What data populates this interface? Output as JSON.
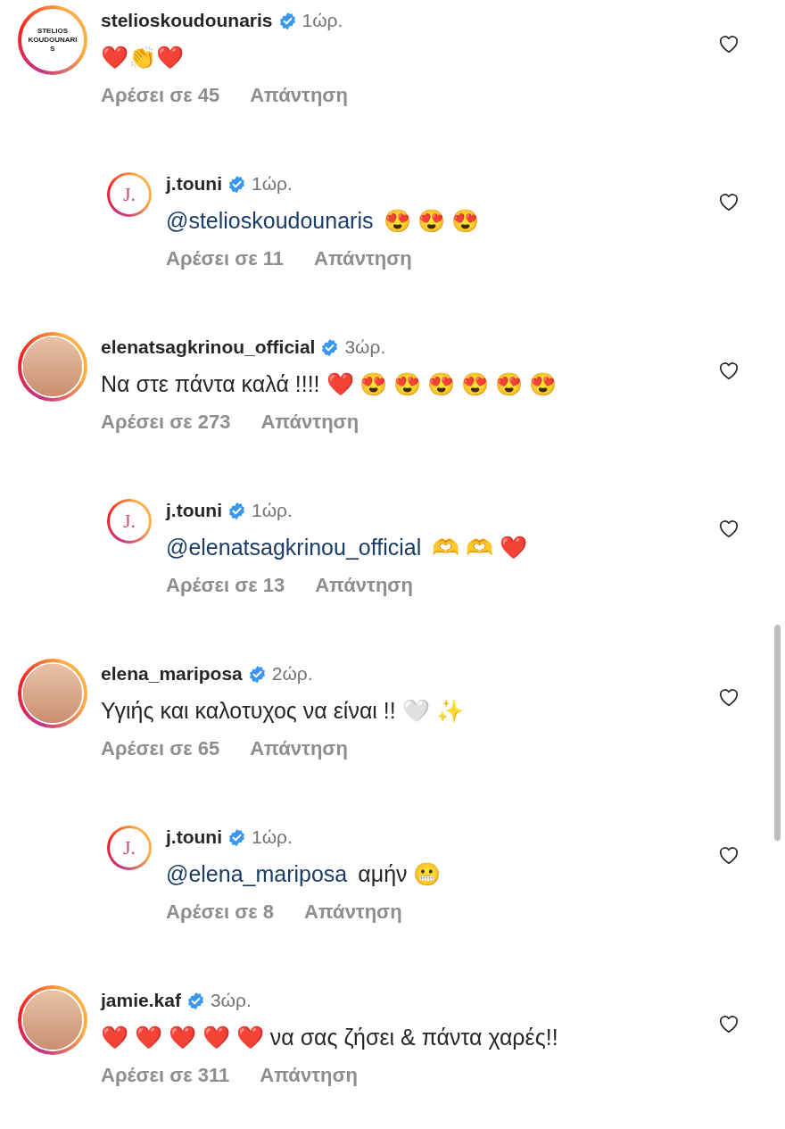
{
  "comments": [
    {
      "username": "stelioskoudounaris",
      "verified": true,
      "time": "1ώρ.",
      "text": "❤️👏❤️",
      "likes": "Αρέσει σε 45",
      "reply": "Απάντηση",
      "avatar": {
        "kind": "logo",
        "text": "STELIOS KOUDOUNARIS"
      },
      "children": [
        {
          "username": "j.touni",
          "verified": true,
          "time": "1ώρ.",
          "mention": "@stelioskoudounaris",
          "text": "😍 😍 😍",
          "likes": "Αρέσει σε 11",
          "reply": "Απάντηση",
          "avatar": {
            "kind": "monogram",
            "text": "J."
          }
        }
      ]
    },
    {
      "username": "elenatsagkrinou_official",
      "verified": true,
      "time": "3ώρ.",
      "text": "Να στε πάντα καλά !!!! ❤️ 😍 😍 😍 😍 😍 😍",
      "likes": "Αρέσει σε 273",
      "reply": "Απάντηση",
      "avatar": {
        "kind": "photo"
      },
      "children": [
        {
          "username": "j.touni",
          "verified": true,
          "time": "1ώρ.",
          "mention": "@elenatsagkrinou_official",
          "text": "🫶 🫶 ❤️",
          "likes": "Αρέσει σε 13",
          "reply": "Απάντηση",
          "avatar": {
            "kind": "monogram",
            "text": "J."
          }
        }
      ]
    },
    {
      "username": "elena_mariposa",
      "verified": true,
      "time": "2ώρ.",
      "text": "Υγιής και καλοτυχος να είναι !! 🤍 ✨",
      "likes": "Αρέσει σε 65",
      "reply": "Απάντηση",
      "avatar": {
        "kind": "photo"
      },
      "children": [
        {
          "username": "j.touni",
          "verified": true,
          "time": "1ώρ.",
          "mention": "@elena_mariposa",
          "text": "αμήν 😬",
          "likes": "Αρέσει σε 8",
          "reply": "Απάντηση",
          "avatar": {
            "kind": "monogram",
            "text": "J."
          }
        }
      ]
    },
    {
      "username": "jamie.kaf",
      "verified": true,
      "time": "3ώρ.",
      "text": "❤️ ❤️ ❤️ ❤️ ❤️ να σας ζήσει & πάντα χαρές!!",
      "likes": "Αρέσει σε 311",
      "reply": "Απάντηση",
      "avatar": {
        "kind": "photo"
      }
    }
  ]
}
